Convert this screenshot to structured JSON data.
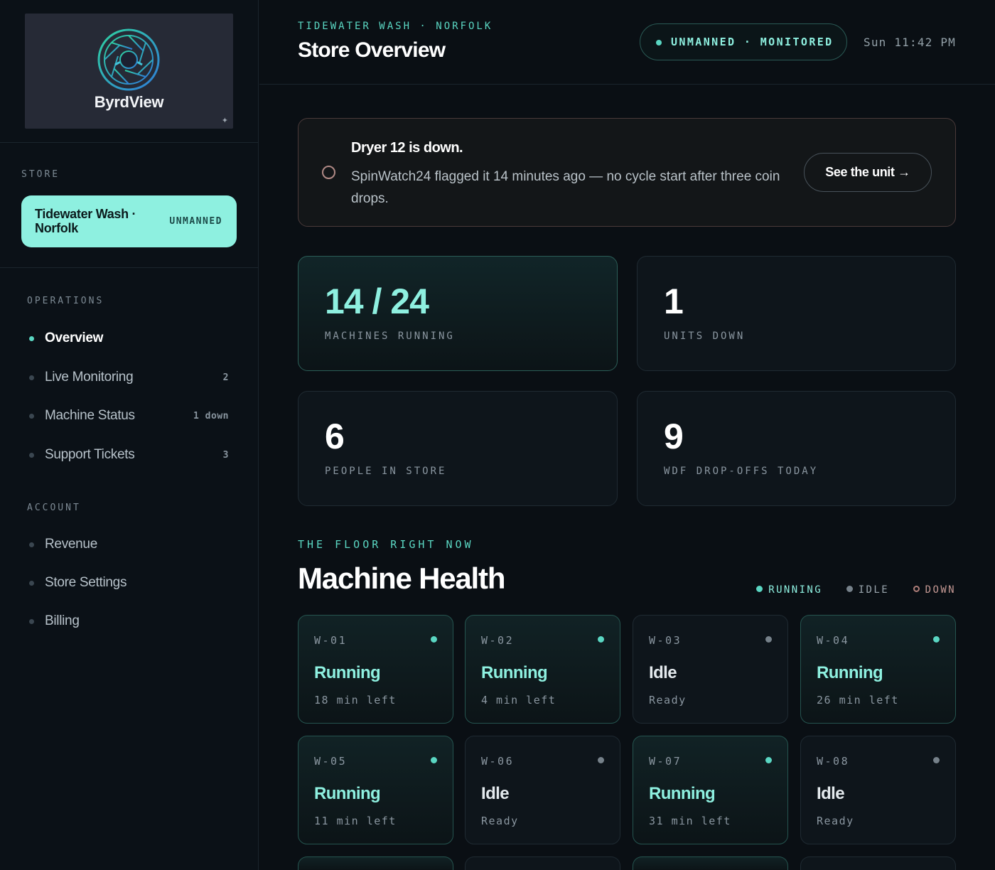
{
  "brand": {
    "name": "ByrdView"
  },
  "sidebar": {
    "store_label": "STORE",
    "store": {
      "name": "Tidewater Wash · Norfolk",
      "tag": "UNMANNED"
    },
    "operations_label": "OPERATIONS",
    "operations": [
      {
        "label": "Overview",
        "count": "",
        "active": true
      },
      {
        "label": "Live Monitoring",
        "count": "2"
      },
      {
        "label": "Machine Status",
        "count": "1 down"
      },
      {
        "label": "Support Tickets",
        "count": "3"
      }
    ],
    "account_label": "ACCOUNT",
    "account": [
      {
        "label": "Revenue"
      },
      {
        "label": "Store Settings"
      },
      {
        "label": "Billing"
      }
    ]
  },
  "header": {
    "eyebrow": "TIDEWATER WASH · NORFOLK",
    "title": "Store Overview",
    "status": "UNMANNED · MONITORED",
    "clock": "Sun 11:42 PM"
  },
  "alert": {
    "title": "Dryer 12 is down.",
    "body": "SpinWatch24 flagged it 14 minutes ago — no cycle start after three coin drops.",
    "button": "See the unit →"
  },
  "stats": [
    {
      "value": "14 / 24",
      "label": "MACHINES RUNNING"
    },
    {
      "value": "1",
      "label": "UNITS DOWN"
    },
    {
      "value": "6",
      "label": "PEOPLE IN STORE"
    },
    {
      "value": "9",
      "label": "WDF DROP-OFFS TODAY"
    }
  ],
  "machine_health": {
    "eyebrow": "THE FLOOR RIGHT NOW",
    "title": "Machine Health",
    "legend": [
      {
        "label": "RUNNING",
        "color": "#5ad6c2"
      },
      {
        "label": "IDLE",
        "color": "#76818a"
      },
      {
        "label": "DOWN",
        "color": "#b07f7a"
      }
    ],
    "machines": [
      {
        "id": "W-01",
        "state": "Running",
        "detail": "18 min left"
      },
      {
        "id": "W-02",
        "state": "Running",
        "detail": "4 min left"
      },
      {
        "id": "W-03",
        "state": "Idle",
        "detail": "Ready"
      },
      {
        "id": "W-04",
        "state": "Running",
        "detail": "26 min left"
      },
      {
        "id": "W-05",
        "state": "Running",
        "detail": "11 min left"
      },
      {
        "id": "W-06",
        "state": "Idle",
        "detail": "Ready"
      },
      {
        "id": "W-07",
        "state": "Running",
        "detail": "31 min left"
      },
      {
        "id": "W-08",
        "state": "Idle",
        "detail": "Ready"
      }
    ]
  },
  "colors": {
    "accent": "#5ad6c2",
    "accent_light": "#8ef0e0",
    "background": "#0a0f14",
    "down": "#b07f7a"
  }
}
